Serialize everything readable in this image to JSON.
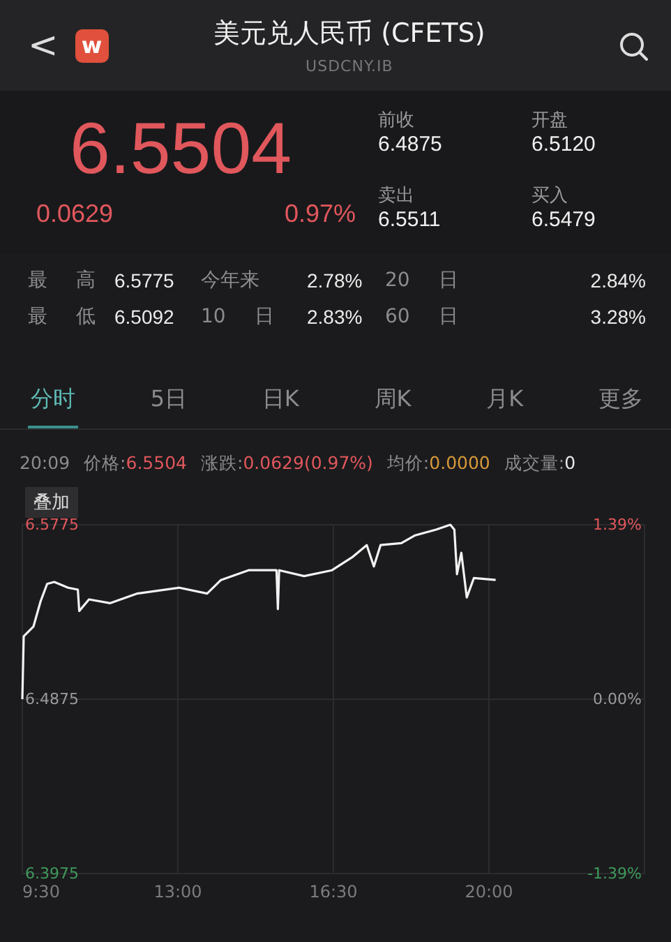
{
  "header": {
    "back": "<",
    "logo": "w",
    "title": "美元兑人民币 (CFETS)",
    "subtitle": "USDCNY.IB"
  },
  "quote": {
    "price": "6.5504",
    "change": "0.0629",
    "percent": "0.97%",
    "fields": [
      {
        "label": "前收",
        "value": "6.4875"
      },
      {
        "label": "开盘",
        "value": "6.5120"
      },
      {
        "label": "卖出",
        "value": "6.5511"
      },
      {
        "label": "买入",
        "value": "6.5479"
      }
    ]
  },
  "stats": [
    [
      {
        "label": "最 高",
        "value": "6.5775"
      },
      {
        "label": "今年来",
        "value": "2.78%"
      },
      {
        "label": "20 日",
        "value": "2.84%"
      }
    ],
    [
      {
        "label": "最 低",
        "value": "6.5092"
      },
      {
        "label": "10 日",
        "value": "2.83%"
      },
      {
        "label": "60 日",
        "value": "3.28%"
      }
    ]
  ],
  "tabs": [
    {
      "label": "分时",
      "selected": true
    },
    {
      "label": "5日",
      "selected": false
    },
    {
      "label": "日K",
      "selected": false
    },
    {
      "label": "周K",
      "selected": false
    },
    {
      "label": "月K",
      "selected": false
    },
    {
      "label": "更多",
      "selected": false
    }
  ],
  "info": {
    "time": "20:09",
    "items": [
      {
        "label": "价格:",
        "value": "6.5504",
        "color": "#e0575c"
      },
      {
        "label": "涨跌:",
        "value": "0.0629(0.97%)",
        "color": "#e0575c"
      },
      {
        "label": "均价:",
        "value": "0.0000",
        "color": "#d8983a"
      },
      {
        "label": "成交量:",
        "value": "0",
        "color": "#e8e8e8"
      }
    ]
  },
  "chart": {
    "overlay_button": "叠加",
    "pct_labels": [
      {
        "text": "1.39%",
        "color": "#e0575c"
      },
      {
        "text": "0.00%",
        "color": "#9a9a9e"
      },
      {
        "text": "-1.39%",
        "color": "#3f9a5c"
      }
    ],
    "chart_data": {
      "type": "line",
      "x": [
        9.5,
        9.53,
        9.75,
        9.91,
        10.06,
        10.22,
        10.53,
        10.75,
        10.78,
        11.0,
        11.47,
        12.09,
        13.03,
        13.66,
        13.97,
        14.59,
        15.22,
        15.25,
        15.28,
        15.84,
        16.47,
        16.94,
        17.25,
        17.41,
        17.56,
        18.03,
        18.34,
        18.81,
        19.13,
        19.22,
        19.28,
        19.38,
        19.5,
        19.66,
        20.15
      ],
      "series": [
        {
          "color": "#f2f2f2",
          "values": [
            6.4875,
            6.52,
            6.525,
            6.538,
            6.547,
            6.548,
            6.545,
            6.544,
            6.533,
            6.539,
            6.537,
            6.542,
            6.545,
            6.542,
            6.549,
            6.554,
            6.554,
            6.534,
            6.554,
            6.551,
            6.554,
            6.561,
            6.567,
            6.556,
            6.567,
            6.568,
            6.572,
            6.575,
            6.5775,
            6.575,
            6.552,
            6.563,
            6.54,
            6.55,
            6.549
          ]
        }
      ],
      "grid": true,
      "xlim": [
        9.5,
        23.5
      ],
      "ylim": [
        6.3975,
        6.5775
      ],
      "xticks": [
        {
          "value": 9.5,
          "label": "9:30"
        },
        {
          "value": 13,
          "label": "13:00"
        },
        {
          "value": 16.5,
          "label": "16:30"
        },
        {
          "value": 20,
          "label": "20:00"
        }
      ],
      "yticks": [
        {
          "value": 6.5775,
          "label": "6.5775"
        },
        {
          "value": 6.4875,
          "label": "6.4875"
        },
        {
          "value": 6.3975,
          "label": "6.3975"
        }
      ]
    }
  }
}
